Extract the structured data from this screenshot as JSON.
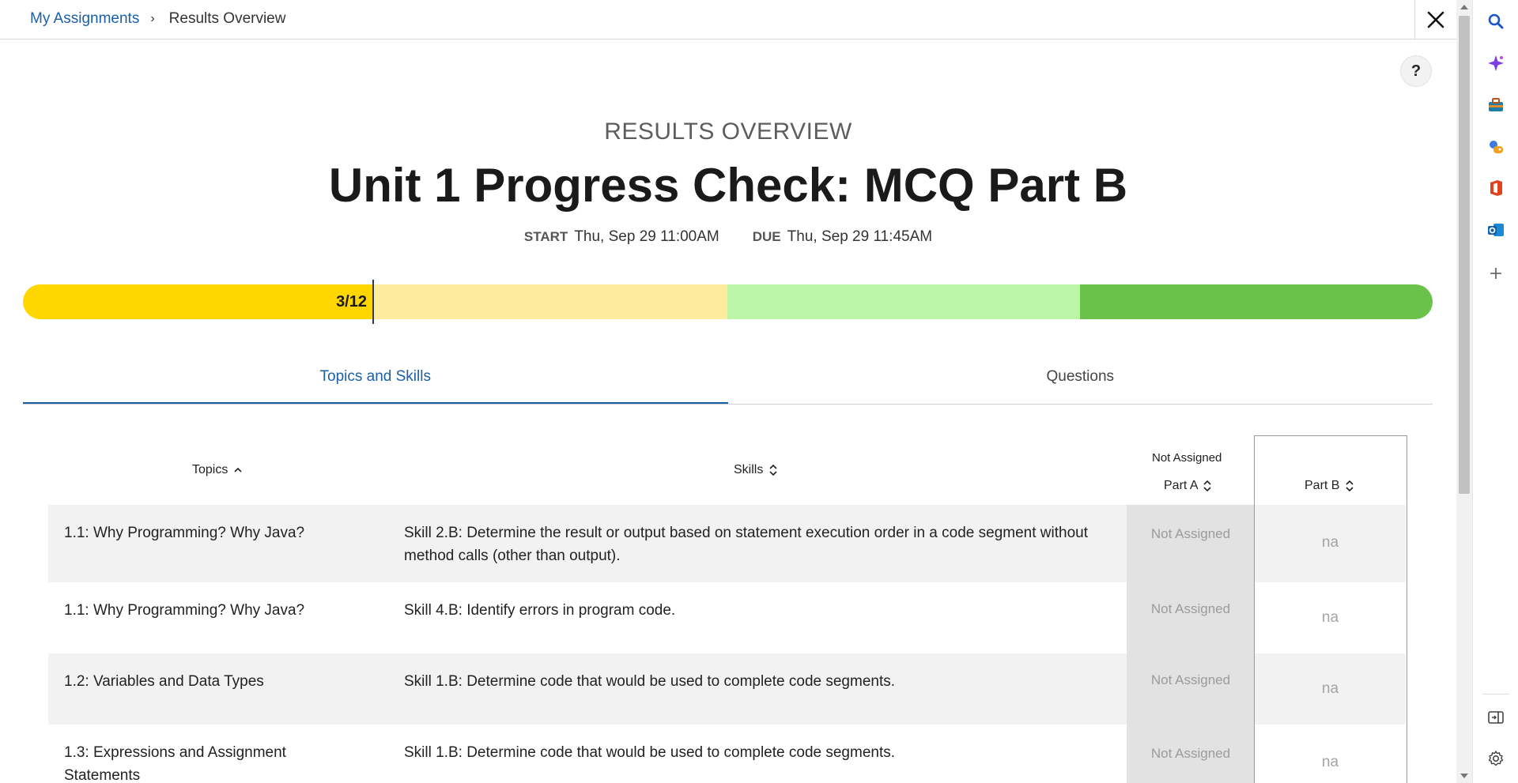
{
  "breadcrumb": {
    "parent": "My Assignments",
    "separator": "›",
    "current": "Results Overview"
  },
  "header": {
    "eyebrow": "RESULTS OVERVIEW",
    "title": "Unit 1 Progress Check: MCQ Part B",
    "start_label": "START",
    "start_value": "Thu, Sep 29 11:00AM",
    "due_label": "DUE",
    "due_value": "Thu, Sep 29 11:45AM"
  },
  "help_label": "?",
  "progress": {
    "label": "3/12",
    "completed": 3,
    "total": 12,
    "colors": [
      "#ffd600",
      "#feeb9b",
      "#bdf5a6",
      "#6bc24a"
    ]
  },
  "tabs": [
    {
      "label": "Topics and Skills",
      "active": true
    },
    {
      "label": "Questions",
      "active": false
    }
  ],
  "table": {
    "columns": {
      "topics": "Topics",
      "skills": "Skills",
      "part_a_group": "Not Assigned",
      "part_a": "Part A",
      "part_b": "Part B"
    },
    "rows": [
      {
        "topic": "1.1: Why Programming? Why Java?",
        "skill": "Skill 2.B: Determine the result or output based on statement execution order in a code segment without method calls (other than output).",
        "part_a": "Not Assigned",
        "part_b": "na"
      },
      {
        "topic": "1.1: Why Programming? Why Java?",
        "skill": "Skill 4.B: Identify errors in program code.",
        "part_a": "Not Assigned",
        "part_b": "na"
      },
      {
        "topic": "1.2: Variables and Data Types",
        "skill": "Skill 1.B: Determine code that would be used to complete code segments.",
        "part_a": "Not Assigned",
        "part_b": "na"
      },
      {
        "topic": "1.3: Expressions and Assignment Statements",
        "skill": "Skill 1.B: Determine code that would be used to complete code segments.",
        "part_a": "Not Assigned",
        "part_b": "na"
      }
    ]
  },
  "sidebar": [
    "search-icon",
    "copilot-icon",
    "tools-icon",
    "games-icon",
    "office-icon",
    "outlook-icon",
    "add-icon",
    "panel-icon",
    "settings-icon"
  ]
}
